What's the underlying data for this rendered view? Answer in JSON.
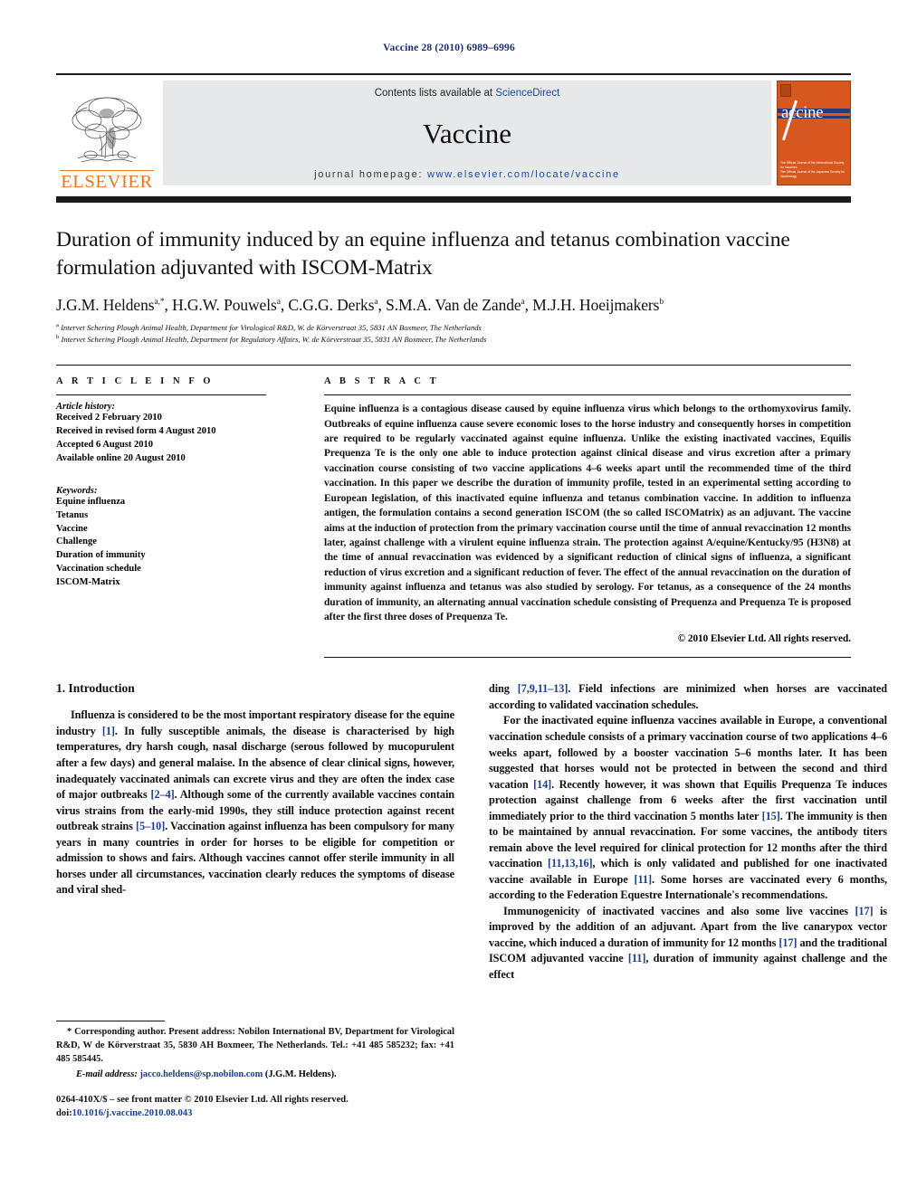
{
  "running_head": "Vaccine 28 (2010) 6989–6996",
  "masthead": {
    "publisher_name": "ELSEVIER",
    "contents_prefix": "Contents lists available at ",
    "contents_link": "ScienceDirect",
    "journal_name": "Vaccine",
    "homepage_prefix": "journal homepage: ",
    "homepage_url": "www.elsevier.com/locate/vaccine",
    "cover_title": "accine",
    "cover_footer_line1": "The Official Journal of the International Society for Vaccines",
    "cover_footer_line2": "The Official Journal of the Japanese Society for Vaccinology"
  },
  "article": {
    "title": "Duration of immunity induced by an equine influenza and tetanus combination vaccine formulation adjuvanted with ISCOM-Matrix",
    "authors": [
      {
        "name": "J.G.M. Heldens",
        "marks": "a,*"
      },
      {
        "name": "H.G.W. Pouwels",
        "marks": "a"
      },
      {
        "name": "C.G.G. Derks",
        "marks": "a"
      },
      {
        "name": "S.M.A. Van de Zande",
        "marks": "a"
      },
      {
        "name": "M.J.H. Hoeijmakers",
        "marks": "b"
      }
    ],
    "affiliations": [
      {
        "mark": "a",
        "text": "Intervet Schering Plough Animal Health, Department for Virological R&D, W. de Körverstraat 35, 5831 AN Boxmeer, The Netherlands"
      },
      {
        "mark": "b",
        "text": "Intervet Schering Plough Animal Health, Department for Regulatory Affairs, W. de Körverstraat 35, 5831 AN Boxmeer, The Netherlands"
      }
    ]
  },
  "article_info": {
    "heading": "A R T I C L E   I N F O",
    "history_label": "Article history:",
    "history": [
      "Received 2 February 2010",
      "Received in revised form 4 August 2010",
      "Accepted 6 August 2010",
      "Available online 20 August 2010"
    ],
    "keywords_label": "Keywords:",
    "keywords": [
      "Equine influenza",
      "Tetanus",
      "Vaccine",
      "Challenge",
      "Duration of immunity",
      "Vaccination schedule",
      "ISCOM-Matrix"
    ]
  },
  "abstract": {
    "heading": "A B S T R A C T",
    "text": "Equine influenza is a contagious disease caused by equine influenza virus which belongs to the orthomyxovirus family. Outbreaks of equine influenza cause severe economic loses to the horse industry and consequently horses in competition are required to be regularly vaccinated against equine influenza. Unlike the existing inactivated vaccines, Equilis Prequenza Te is the only one able to induce protection against clinical disease and virus excretion after a primary vaccination course consisting of two vaccine applications 4–6 weeks apart until the recommended time of the third vaccination. In this paper we describe the duration of immunity profile, tested in an experimental setting according to European legislation, of this inactivated equine influenza and tetanus combination vaccine. In addition to influenza antigen, the formulation contains a second generation ISCOM (the so called ISCOMatrix) as an adjuvant. The vaccine aims at the induction of protection from the primary vaccination course until the time of annual revaccination 12 months later, against challenge with a virulent equine influenza strain. The protection against A/equine/Kentucky/95 (H3N8) at the time of annual revaccination was evidenced by a significant reduction of clinical signs of influenza, a significant reduction of virus excretion and a significant reduction of fever. The effect of the annual revaccination on the duration of immunity against influenza and tetanus was also studied by serology. For tetanus, as a consequence of the 24 months duration of immunity, an alternating annual vaccination schedule consisting of Prequenza and Prequenza Te is proposed after the first three doses of Prequenza Te.",
    "copyright": "© 2010 Elsevier Ltd. All rights reserved."
  },
  "introduction": {
    "heading": "1.  Introduction",
    "left_paragraph_1_a": "Influenza is considered to be the most important respiratory disease for the equine industry ",
    "left_ref_1": "[1]",
    "left_paragraph_1_b": ". In fully susceptible animals, the disease is characterised by high temperatures, dry harsh cough, nasal discharge (serous followed by mucopurulent after a few days) and general malaise. In the absence of clear clinical signs, however, inadequately vaccinated animals can excrete virus and they are often the index case of major outbreaks ",
    "left_ref_2": "[2–4]",
    "left_paragraph_1_c": ". Although some of the currently available vaccines contain virus strains from the early-mid 1990s, they still induce protection against recent outbreak strains ",
    "left_ref_3": "[5–10]",
    "left_paragraph_1_d": ". Vaccination against influenza has been compulsory for many years in many countries in order for horses to be eligible for competition or admission to shows and fairs. Although vaccines cannot offer sterile immunity in all horses under all circumstances, vaccination clearly reduces the symptoms of disease and viral shed-",
    "right_paragraph_1_a": "ding ",
    "right_ref_1": "[7,9,11–13]",
    "right_paragraph_1_b": ". Field infections are minimized when horses are vaccinated according to validated vaccination schedules.",
    "right_paragraph_2_a": "For the inactivated equine influenza vaccines available in Europe, a conventional vaccination schedule consists of a primary vaccination course of two applications 4–6 weeks apart, followed by a booster vaccination 5–6 months later. It has been suggested that horses would not be protected in between the second and third vacation ",
    "right_ref_2": "[14]",
    "right_paragraph_2_b": ". Recently however, it was shown that Equilis Prequenza Te induces protection against challenge from 6 weeks after the first vaccination until immediately prior to the third vaccination 5 months later ",
    "right_ref_3": "[15]",
    "right_paragraph_2_c": ". The immunity is then to be maintained by annual revaccination. For some vaccines, the antibody titers remain above the level required for clinical protection for 12 months after the third vaccination ",
    "right_ref_4": "[11,13,16]",
    "right_paragraph_2_d": ", which is only validated and published for one inactivated vaccine available in Europe ",
    "right_ref_5": "[11]",
    "right_paragraph_2_e": ". Some horses are vaccinated every 6 months, according to the Federation Equestre Internationale's recommendations.",
    "right_paragraph_3_a": "Immunogenicity of inactivated vaccines and also some live vaccines ",
    "right_ref_6": "[17]",
    "right_paragraph_3_b": " is improved by the addition of an adjuvant. Apart from the live canarypox vector vaccine, which induced a duration of immunity for 12 months ",
    "right_ref_7": "[17]",
    "right_paragraph_3_c": " and the traditional ISCOM adjuvanted vaccine ",
    "right_ref_8": "[11]",
    "right_paragraph_3_d": ", duration of immunity against challenge and the effect"
  },
  "footnotes": {
    "corresponding": "* Corresponding author. Present address: Nobilon International BV, Department for Virological R&D, W de Körverstraat 35, 5830 AH Boxmeer, The Netherlands. Tel.: +41 485 585232; fax: +41 485 585445.",
    "email_label": "E-mail address:",
    "email": "jacco.heldens@sp.nobilon.com",
    "email_suffix": " (J.G.M. Heldens)."
  },
  "imprint": {
    "issn_line": "0264-410X/$ – see front matter © 2010 Elsevier Ltd. All rights reserved.",
    "doi_prefix": "doi:",
    "doi": "10.1016/j.vaccine.2010.08.043"
  },
  "colors": {
    "elsevier_orange": "#E87722",
    "link_blue": "#1a4b9c",
    "ref_blue": "#1a3e8c",
    "band_gray": "#e7e8ea",
    "cover_orange": "#D8571F"
  }
}
